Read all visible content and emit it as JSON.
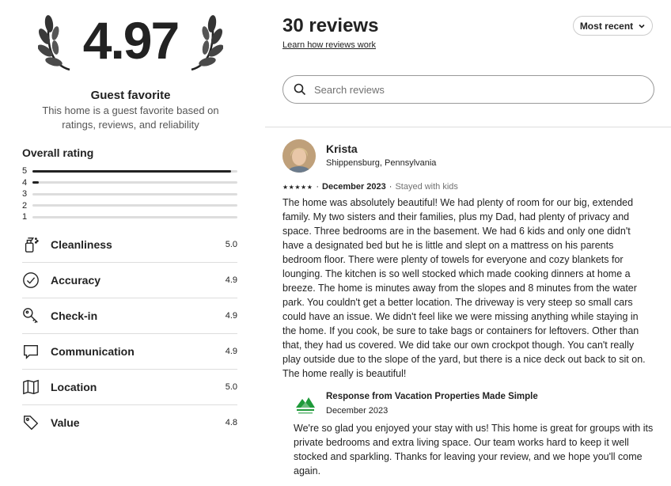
{
  "summary": {
    "rating": "4.97",
    "badge_title": "Guest favorite",
    "badge_desc": "This home is a guest favorite based on ratings, reviews, and reliability"
  },
  "overall": {
    "title": "Overall rating",
    "histogram": [
      {
        "stars": "5",
        "fraction": 0.97
      },
      {
        "stars": "4",
        "fraction": 0.03
      },
      {
        "stars": "3",
        "fraction": 0
      },
      {
        "stars": "2",
        "fraction": 0
      },
      {
        "stars": "1",
        "fraction": 0
      }
    ]
  },
  "categories": [
    {
      "label": "Cleanliness",
      "score": "5.0",
      "icon": "spray-bottle-icon"
    },
    {
      "label": "Accuracy",
      "score": "4.9",
      "icon": "check-circle-icon"
    },
    {
      "label": "Check-in",
      "score": "4.9",
      "icon": "key-icon"
    },
    {
      "label": "Communication",
      "score": "4.9",
      "icon": "chat-bubble-icon"
    },
    {
      "label": "Location",
      "score": "5.0",
      "icon": "map-icon"
    },
    {
      "label": "Value",
      "score": "4.8",
      "icon": "price-tag-icon"
    }
  ],
  "reviews_header": {
    "title": "30 reviews",
    "learn_link": "Learn how reviews work",
    "sort_label": "Most recent"
  },
  "search": {
    "placeholder": "Search reviews"
  },
  "review": {
    "name": "Krista",
    "location": "Shippensburg, Pennsylvania",
    "stars": "★★★★★",
    "date": "December 2023",
    "stay_type": "Stayed with kids",
    "text": "The home was absolutely beautiful! We had plenty of room for our big, extended family. My two sisters and their families, plus my Dad, had plenty of privacy and space. Three bedrooms are in the basement. We had 6 kids and only one didn't have a designated bed but he is little and slept on a mattress on his parents bedroom floor. There were plenty of towels for everyone and cozy blankets for lounging. The kitchen is so well stocked which made cooking dinners at home a breeze. The home is minutes away from the slopes and 8 minutes from the water park. You couldn't get a better location. The driveway is very steep so small cars could have an issue. We didn't feel like we were missing anything while staying in the home. If you cook, be sure to take bags or containers for leftovers. Other than that, they had us covered. We did take our own crockpot though. You can't really play outside due to the slope of the yard, but there is a nice deck out back to sit on. The home really is beautiful!",
    "response": {
      "title": "Response from Vacation Properties Made Simple",
      "date": "December 2023",
      "text": "We're so glad you enjoyed your stay with us! This home is great for groups with its private bedrooms and extra living space. Our team works hard to keep it well stocked and sparkling. Thanks for leaving your review, and we hope you'll come again."
    }
  },
  "colors": {
    "text": "#222222",
    "muted": "#717171",
    "divider": "#dddddd",
    "host_logo_green": "#1f9a3a"
  }
}
